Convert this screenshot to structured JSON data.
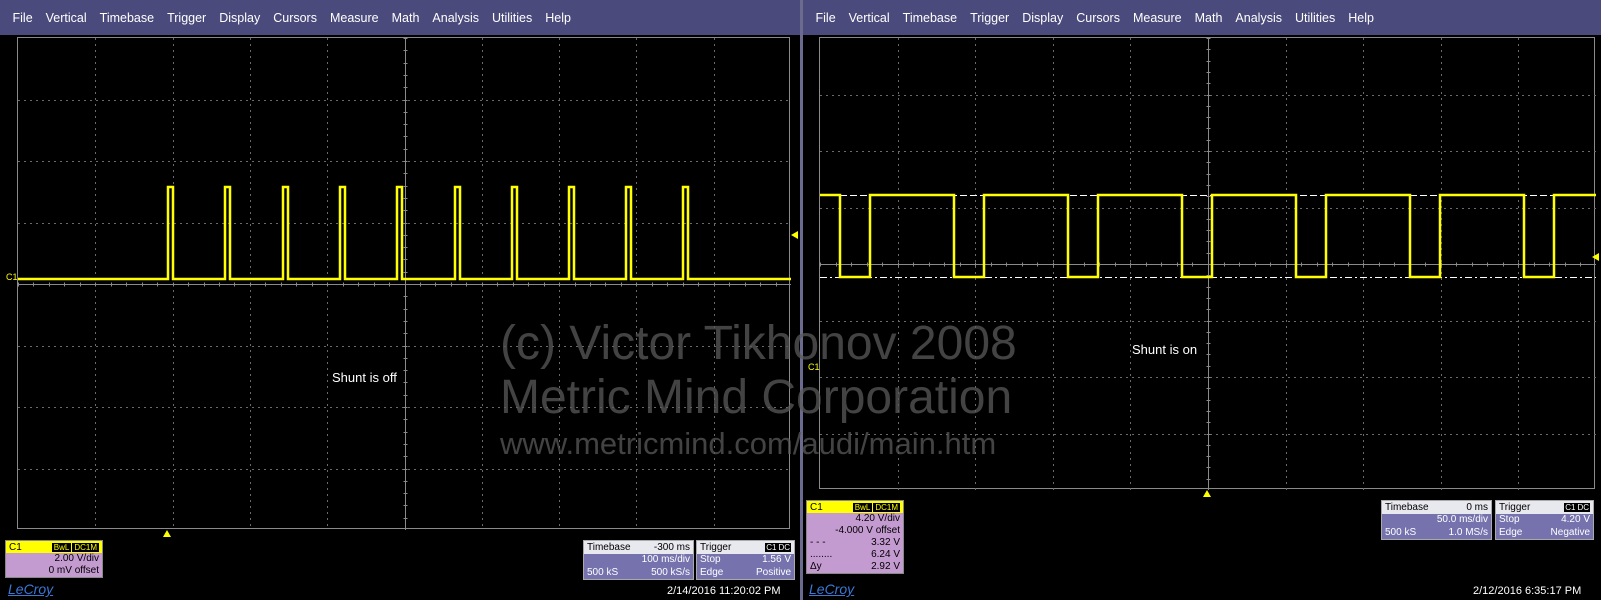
{
  "left": {
    "menu": [
      "File",
      "Vertical",
      "Timebase",
      "Trigger",
      "Display",
      "Cursors",
      "Measure",
      "Math",
      "Analysis",
      "Utilities",
      "Help"
    ],
    "annotation": "Shunt is off",
    "channel_tag": "C1",
    "channel_box": {
      "name": "C1",
      "badges": [
        "BwL",
        "DC1M"
      ],
      "rows": [
        [
          "",
          "2.00 V/div"
        ],
        [
          "",
          "0 mV offset"
        ]
      ]
    },
    "timebase": {
      "title": "Timebase",
      "value": "-300 ms",
      "rows": [
        [
          "",
          "100 ms/div"
        ],
        [
          "500 kS",
          "500 kS/s"
        ]
      ]
    },
    "trigger": {
      "title": "Trigger",
      "badges": [
        "C1",
        "DC"
      ],
      "rows": [
        [
          "Stop",
          "1.56 V"
        ],
        [
          "Edge",
          "Positive"
        ]
      ]
    },
    "brand": "LeCroy",
    "datetime": "2/14/2016 11:20:02 PM"
  },
  "right": {
    "menu": [
      "File",
      "Vertical",
      "Timebase",
      "Trigger",
      "Display",
      "Cursors",
      "Measure",
      "Math",
      "Analysis",
      "Utilities",
      "Help"
    ],
    "annotation": "Shunt is on",
    "channel_tag": "C1",
    "channel_box": {
      "name": "C1",
      "badges": [
        "BwL",
        "DC1M"
      ],
      "rows": [
        [
          "",
          "4.20 V/div"
        ],
        [
          "",
          "-4.000 V offset"
        ],
        [
          "- - -",
          "3.32 V"
        ],
        [
          "........",
          "6.24 V"
        ],
        [
          "Δy",
          "2.92 V"
        ]
      ]
    },
    "timebase": {
      "title": "Timebase",
      "value": "0 ms",
      "rows": [
        [
          "",
          "50.0 ms/div"
        ],
        [
          "500 kS",
          "1.0 MS/s"
        ]
      ]
    },
    "trigger": {
      "title": "Trigger",
      "badges": [
        "C1",
        "DC"
      ],
      "rows": [
        [
          "Stop",
          "4.20 V"
        ],
        [
          "Edge",
          "Negative"
        ]
      ]
    },
    "brand": "LeCroy",
    "datetime": "2/12/2016 6:35:17 PM"
  },
  "watermark": [
    "(c) Victor Tikhonov 2008",
    "Metric Mind Corporation",
    "www.metricmind.com/audi/main.htm"
  ],
  "colors": {
    "trace": "#ffff00",
    "menubar": "#4a4a7c",
    "channel_box": "#c49bd0",
    "info_box": "#7572ad",
    "grid": "#8a8a8a"
  }
}
